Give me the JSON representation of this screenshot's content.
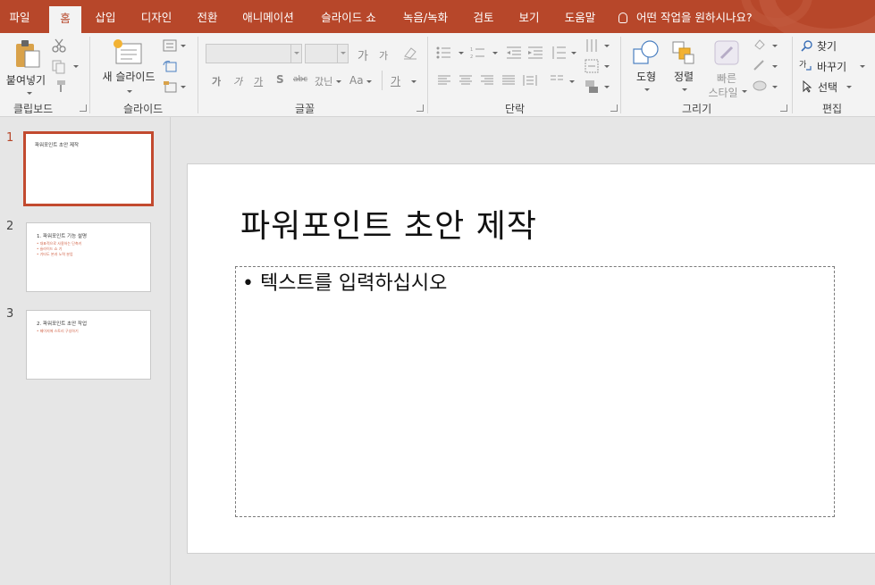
{
  "tabs": [
    {
      "label": "파일",
      "active": false
    },
    {
      "label": "홈",
      "active": true
    },
    {
      "label": "삽입",
      "active": false
    },
    {
      "label": "디자인",
      "active": false
    },
    {
      "label": "전환",
      "active": false
    },
    {
      "label": "애니메이션",
      "active": false
    },
    {
      "label": "슬라이드 쇼",
      "active": false
    },
    {
      "label": "녹음/녹화",
      "active": false
    },
    {
      "label": "검토",
      "active": false
    },
    {
      "label": "보기",
      "active": false
    },
    {
      "label": "도움말",
      "active": false
    }
  ],
  "tellme": "어떤 작업을 원하시나요?",
  "ribbon": {
    "clipboard": {
      "paste": "붙여넣기",
      "group": "클립보드"
    },
    "slides": {
      "new_slide": "새 슬라이드",
      "group": "슬라이드"
    },
    "font": {
      "group": "글꼴",
      "grow": "가",
      "shrink": "가",
      "bold": "가",
      "italic": "가",
      "underline": "가",
      "shadow": "S",
      "strike": "abc",
      "spacing": "갔닌",
      "case": "Aa",
      "color": "가"
    },
    "paragraph": {
      "group": "단락"
    },
    "drawing": {
      "shapes": "도형",
      "arrange": "정렬",
      "quick_styles_1": "빠른",
      "quick_styles_2": "스타일",
      "group": "그리기"
    },
    "editing": {
      "find": "찾기",
      "replace": "바꾸기",
      "select": "선택",
      "group": "편집"
    }
  },
  "colors": {
    "accent": "#b7472a",
    "selection_border": "#c24a2f"
  },
  "thumbnails": [
    {
      "num": "1",
      "title": "파워포인트 초안 제작",
      "bullets": [],
      "selected": true
    },
    {
      "num": "2",
      "title": "1. 파워포인트 기능 설명",
      "bullets": [
        "• 대표적으로 사용하는 단축키",
        "• 슬라이드 쇼 기",
        "• 기타도 본과 노력 분업"
      ],
      "selected": false
    },
    {
      "num": "3",
      "title": "2. 파워포인트 초안 작업",
      "bullets": [
        "• 페이지에 스토리 구성하기"
      ],
      "selected": false
    }
  ],
  "slide": {
    "title": "파워포인트 초안 제작",
    "body_bullet": "• 텍스트를 입력하십시오"
  }
}
